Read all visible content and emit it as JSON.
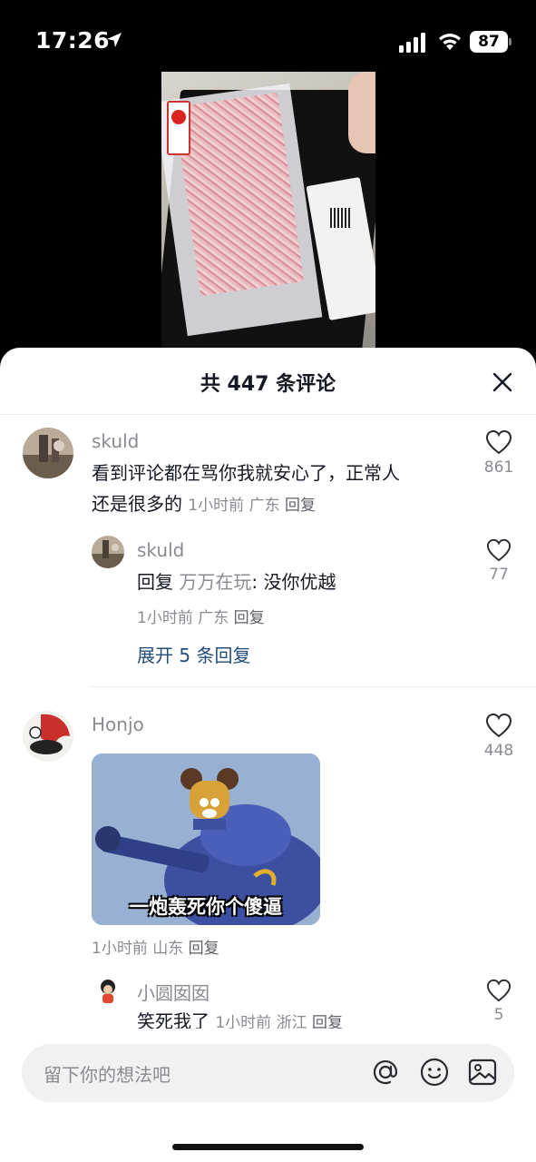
{
  "status": {
    "time": "17:26",
    "battery": "87"
  },
  "sheet": {
    "title": "共 447 条评论"
  },
  "comments": [
    {
      "user": "skuld",
      "text_line1": "看到评论都在骂你我就安心了，正常人",
      "text_line2": "还是很多的",
      "time": "1小时前",
      "location": "广东",
      "reply": "回复",
      "likes": "861",
      "replies": [
        {
          "user": "skuld",
          "prefix": "回复",
          "reply_to": "万万在玩",
          "text": ": 没你优越",
          "time": "1小时前",
          "location": "广东",
          "reply": "回复",
          "likes": "77"
        }
      ],
      "expand": "展开 5 条回复"
    },
    {
      "user": "Honjo",
      "sticker_caption": "一炮轰死你个傻逼",
      "time": "1小时前",
      "location": "山东",
      "reply": "回复",
      "likes": "448",
      "replies": [
        {
          "user": "小圆囡囡",
          "text": "笑死我了",
          "time": "1小时前",
          "location": "浙江",
          "reply": "回复",
          "likes": "5"
        }
      ]
    }
  ],
  "input": {
    "placeholder": "留下你的想法吧"
  },
  "icons": [
    "location-arrow-icon",
    "signal-icon",
    "wifi-icon",
    "battery-icon",
    "close-icon",
    "heart-icon",
    "at-icon",
    "emoji-icon",
    "image-icon"
  ]
}
